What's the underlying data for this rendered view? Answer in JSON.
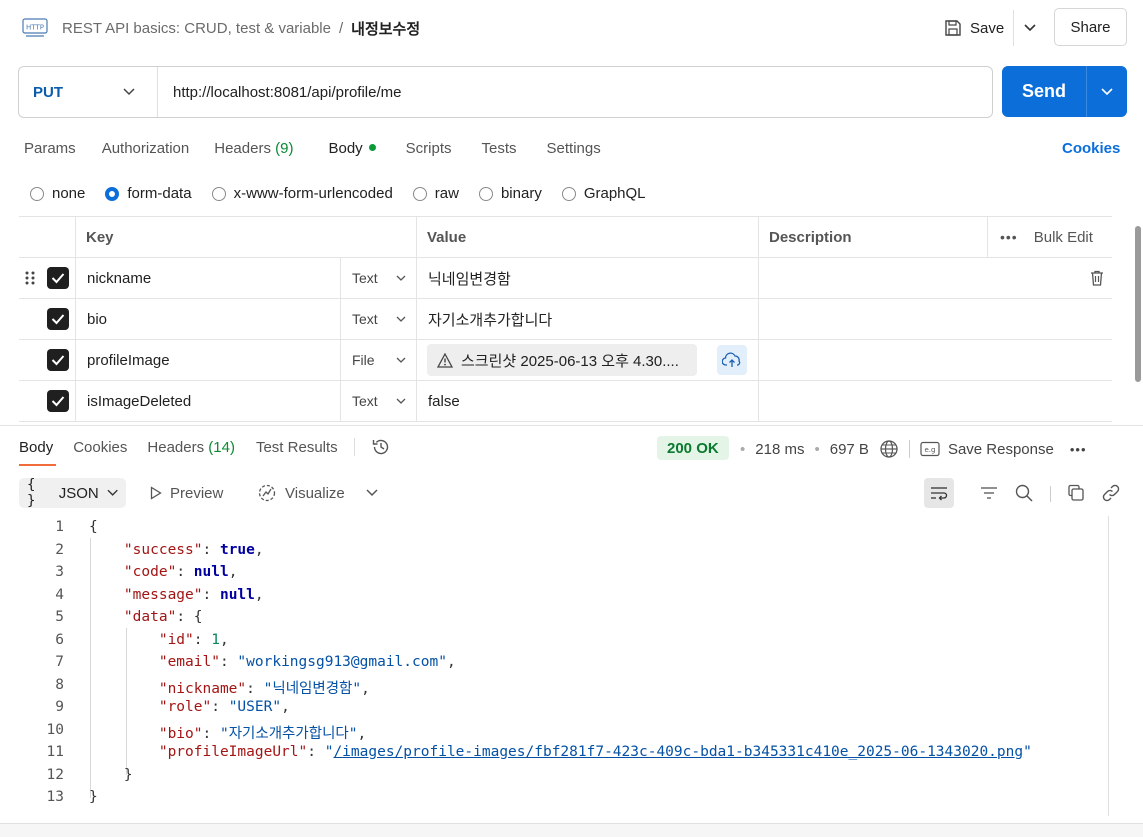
{
  "header": {
    "collection": "REST API basics: CRUD, test & variable",
    "separator": "/",
    "request_name": "내정보수정",
    "save_label": "Save",
    "share_label": "Share",
    "http_badge": "HTTP"
  },
  "url_bar": {
    "method": "PUT",
    "url": "http://localhost:8081/api/profile/me",
    "send_label": "Send"
  },
  "request_tabs": [
    {
      "label": "Params",
      "active": false
    },
    {
      "label": "Authorization",
      "active": false
    },
    {
      "label": "Headers",
      "count": "(9)",
      "active": false
    },
    {
      "label": "Body",
      "active": true
    },
    {
      "label": "Scripts",
      "active": false
    },
    {
      "label": "Tests",
      "active": false
    },
    {
      "label": "Settings",
      "active": false
    }
  ],
  "cookies_label": "Cookies",
  "body_types": [
    "none",
    "form-data",
    "x-www-form-urlencoded",
    "raw",
    "binary",
    "GraphQL"
  ],
  "body_type_selected": "form-data",
  "form_table": {
    "headers": {
      "key": "Key",
      "value": "Value",
      "description": "Description",
      "bulk_edit": "Bulk Edit"
    },
    "rows": [
      {
        "key": "nickname",
        "type": "Text",
        "value": "닉네임변경함",
        "checked": true
      },
      {
        "key": "bio",
        "type": "Text",
        "value": "자기소개추가합니다",
        "checked": true
      },
      {
        "key": "profileImage",
        "type": "File",
        "value": "스크린샷 2025-06-13 오후 4.30....",
        "checked": true
      },
      {
        "key": "isImageDeleted",
        "type": "Text",
        "value": "false",
        "checked": true
      }
    ]
  },
  "response": {
    "tabs": [
      {
        "label": "Body",
        "active": true
      },
      {
        "label": "Cookies",
        "active": false
      },
      {
        "label": "Headers",
        "count": "(14)",
        "active": false
      },
      {
        "label": "Test Results",
        "active": false
      }
    ],
    "status": "200 OK",
    "time": "218 ms",
    "size": "697 B",
    "save_response": "Save Response",
    "format": "JSON",
    "preview_label": "Preview",
    "visualize_label": "Visualize",
    "code": {
      "success_key": "\"success\"",
      "success_val": "true",
      "code_key": "\"code\"",
      "code_val": "null",
      "message_key": "\"message\"",
      "message_val": "null",
      "data_key": "\"data\"",
      "id_key": "\"id\"",
      "id_val": "1",
      "email_key": "\"email\"",
      "email_val": "\"workingsg913@gmail.com\"",
      "nickname_key": "\"nickname\"",
      "nickname_val": "\"닉네임변경함\"",
      "role_key": "\"role\"",
      "role_val": "\"USER\"",
      "bio_key": "\"bio\"",
      "bio_val": "\"자기소개추가합니다\"",
      "url_key": "\"profileImageUrl\"",
      "url_val": "/images/profile-images/fbf281f7-423c-409c-bda1-b345331c410e_2025-06-1343020.png"
    }
  },
  "colors": {
    "accent": "#0c6ed9",
    "status_ok": "#0a7a2e",
    "active_tab": "#f26b3a"
  }
}
